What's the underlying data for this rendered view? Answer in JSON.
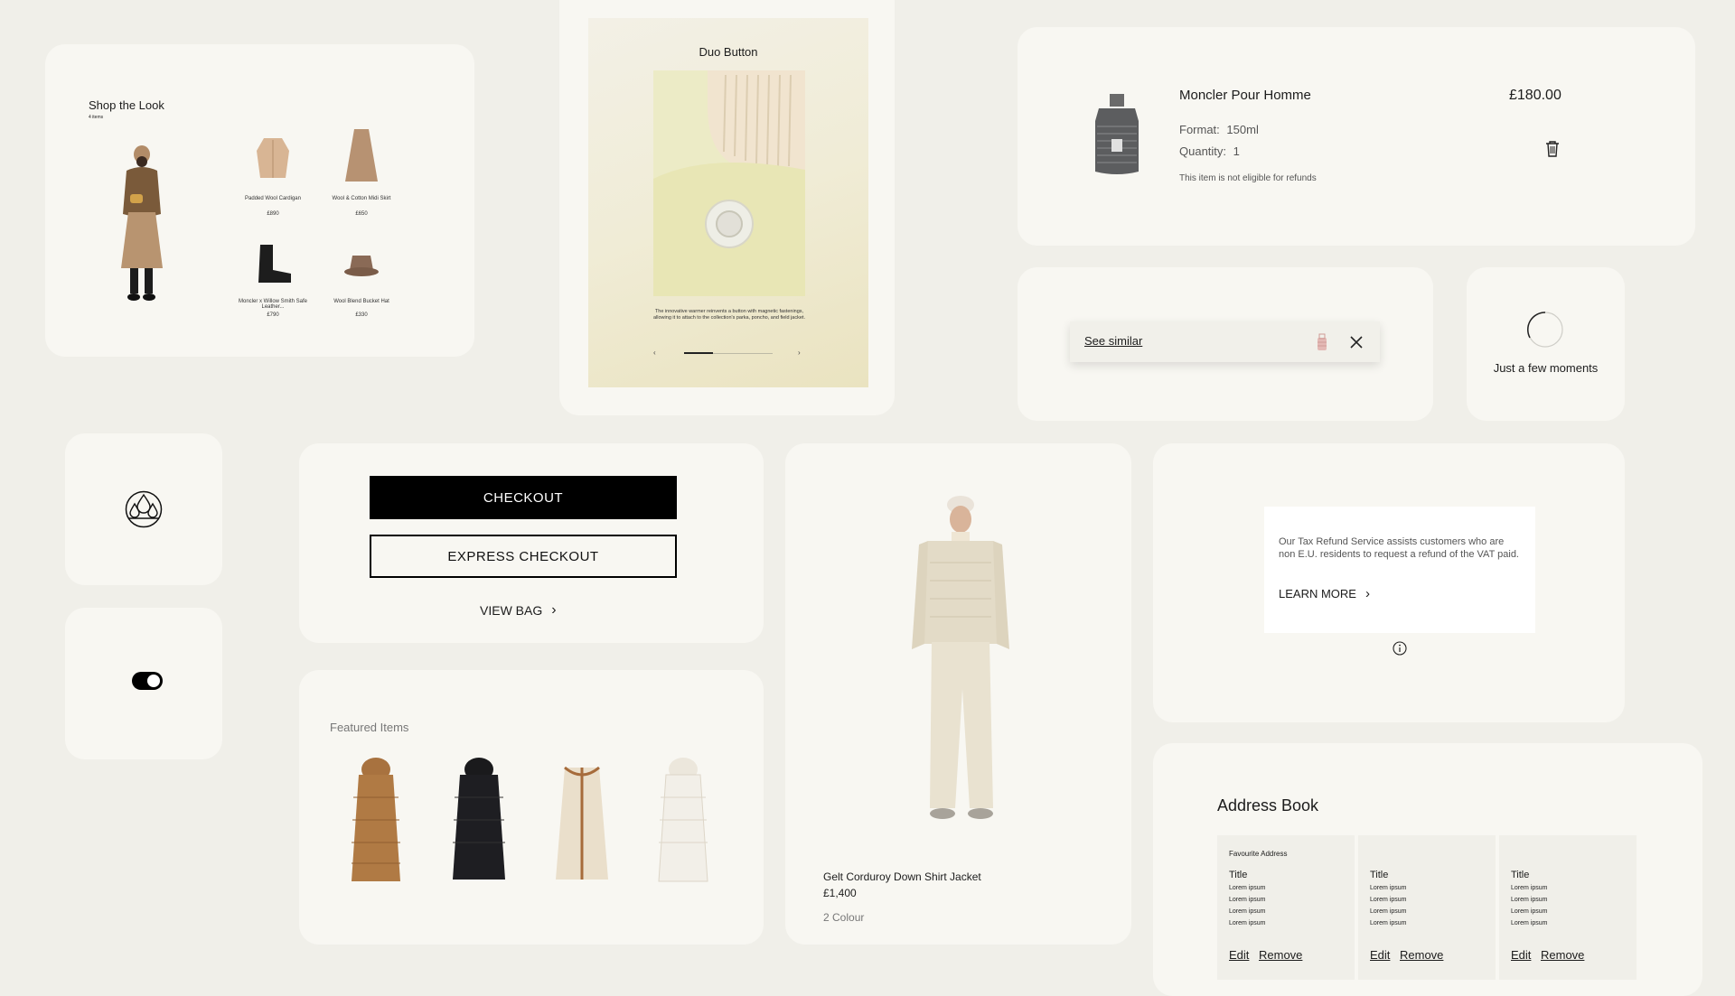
{
  "shop_the_look": {
    "title": "Shop the Look",
    "count": "4 items",
    "items": [
      {
        "name": "Padded Wool Cardigan",
        "price": "£890"
      },
      {
        "name": "Wool & Cotton Midi Skirt",
        "price": "£650"
      },
      {
        "name": "Moncler x Willow Smith Safe Leather...",
        "price": "£790"
      },
      {
        "name": "Wool Blend Bucket Hat",
        "price": "£330"
      }
    ]
  },
  "duo_button": {
    "title": "Duo Button",
    "description": "The innovative warmer reinvents a button with magnetic fastenings, allowing it to attach to the collection's parka, poncho, and field jacket.",
    "progress": 0.33
  },
  "cart_item": {
    "name": "Moncler Pour Homme",
    "price": "£180.00",
    "format_label": "Format:",
    "format_value": "150ml",
    "quantity_label": "Quantity:",
    "quantity_value": "1",
    "note": "This item is not eligible for refunds"
  },
  "see_similar": {
    "label": "See similar"
  },
  "loader": {
    "text": "Just a few moments"
  },
  "toggle": {
    "state": "on"
  },
  "checkout": {
    "checkout_label": "CHECKOUT",
    "express_label": "EXPRESS CHECKOUT",
    "view_bag_label": "VIEW BAG"
  },
  "product": {
    "name": "Gelt Corduroy Down Shirt Jacket",
    "price": "£1,400",
    "colours": "2 Colour"
  },
  "tax_refund": {
    "text": "Our Tax Refund Service assists customers who are non E.U. residents to request a refund of the VAT paid.",
    "link": "LEARN MORE"
  },
  "featured": {
    "title": "Featured Items"
  },
  "address_book": {
    "title": "Address Book",
    "columns": [
      {
        "badge": "Favourite Address",
        "title": "Title",
        "lines": [
          "Lorem ipsum",
          "Lorem ipsum",
          "Lorem ipsum",
          "Lorem ipsum"
        ],
        "edit": "Edit",
        "remove": "Remove"
      },
      {
        "badge": "",
        "title": "Title",
        "lines": [
          "Lorem ipsum",
          "Lorem ipsum",
          "Lorem ipsum",
          "Lorem ipsum"
        ],
        "edit": "Edit",
        "remove": "Remove"
      },
      {
        "badge": "",
        "title": "Title",
        "lines": [
          "Lorem ipsum",
          "Lorem ipsum",
          "Lorem ipsum",
          "Lorem ipsum"
        ],
        "edit": "Edit",
        "remove": "Remove"
      }
    ]
  },
  "icons": [
    "water-drops-icon",
    "toggle-icon",
    "trash-icon",
    "close-icon",
    "chevron-right-icon",
    "info-icon",
    "spinner-icon",
    "chevron-left-icon",
    "bag-thumbnail-icon"
  ]
}
